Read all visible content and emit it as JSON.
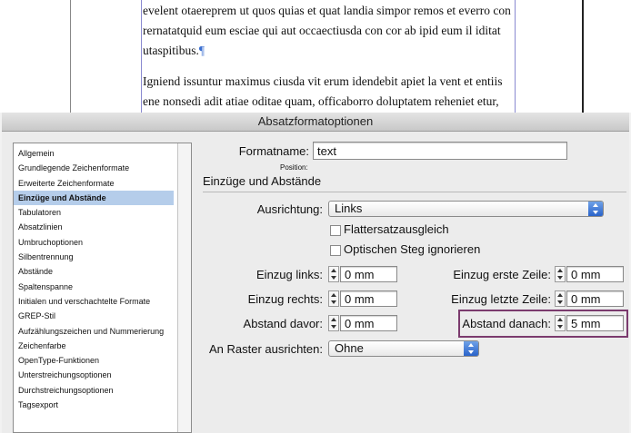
{
  "document": {
    "paragraph1_line1": "evelent otaereprem ut quos quias et quat landia simpor remos et everro con",
    "paragraph1_line2": "rernatatquid eum esciae qui aut occaectiusda con cor ab ipid eum il iditat",
    "paragraph1_line3": "utaspitibus.",
    "pilcrow": "¶",
    "paragraph2_line1": "Igniend issuntur maximus ciusda vit erum idendebit apiet la vent et entiis",
    "paragraph2_line2": "ene nonsedi adit atiae oditae quam, officaborro doluptatem reheniet etur,"
  },
  "dialog": {
    "title": "Absatzformatoptionen",
    "categories": [
      "Allgemein",
      "Grundlegende Zeichenformate",
      "Erweiterte Zeichenformate",
      "Einzüge und Abstände",
      "Tabulatoren",
      "Absatzlinien",
      "Umbruchoptionen",
      "Silbentrennung",
      "Abstände",
      "Spaltenspanne",
      "Initialen und verschachtelte Formate",
      "GREP-Stil",
      "Aufzählungszeichen und Nummerierung",
      "Zeichenfarbe",
      "OpenType-Funktionen",
      "Unterstreichungsoptionen",
      "Durchstreichungsoptionen",
      "Tagsexport"
    ],
    "selected_category": "Einzüge und Abstände",
    "format_name_label": "Formatname:",
    "format_name_value": "text",
    "position_label": "Position:",
    "section_title": "Einzüge und Abstände",
    "alignment_label": "Ausrichtung:",
    "alignment_value": "Links",
    "checkbox_flattersatz": "Flattersatzausgleich",
    "checkbox_optischer_steg": "Optischen Steg ignorieren",
    "indent_left_label": "Einzug links:",
    "indent_left_value": "0 mm",
    "indent_right_label": "Einzug rechts:",
    "indent_right_value": "0 mm",
    "space_before_label": "Abstand davor:",
    "space_before_value": "0 mm",
    "first_line_label": "Einzug erste Zeile:",
    "first_line_value": "0 mm",
    "last_line_label": "Einzug letzte Zeile:",
    "last_line_value": "0 mm",
    "space_after_label": "Abstand danach:",
    "space_after_value": "5 mm",
    "grid_label": "An Raster ausrichten:",
    "grid_value": "Ohne"
  },
  "colors": {
    "selection": "#b5cdea",
    "highlight_border": "#7b3b6e",
    "select_button": "#2a63c9"
  }
}
